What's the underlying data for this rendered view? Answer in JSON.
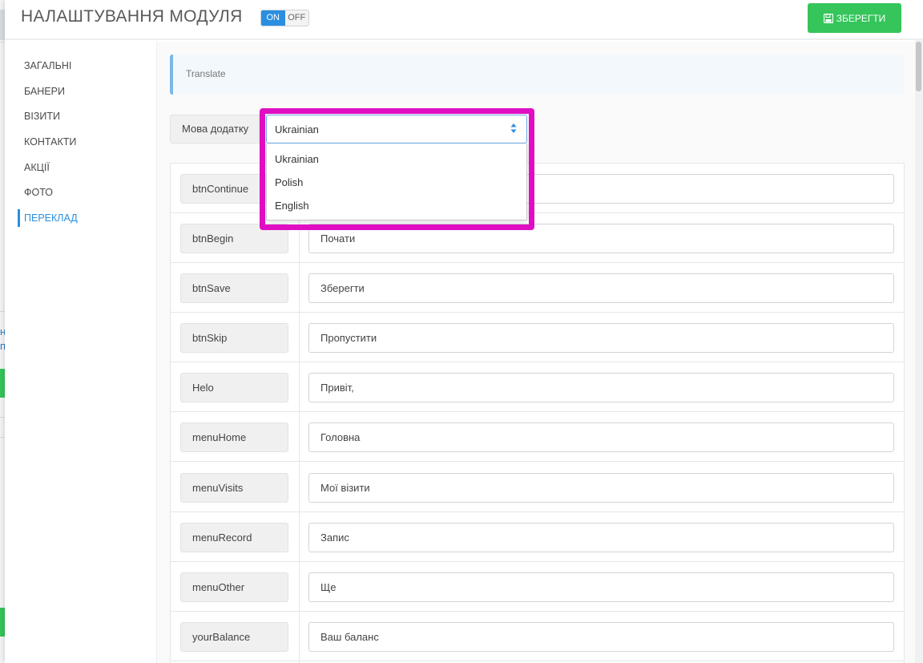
{
  "header": {
    "title": "НАЛАШТУВАННЯ МОДУЛЯ",
    "toggle": {
      "on_label": "ON",
      "off_label": "OFF"
    },
    "save_label": "ЗБЕРЕГТИ"
  },
  "sidebar": {
    "items": [
      {
        "label": "ЗАГАЛЬНІ"
      },
      {
        "label": "БАНЕРИ"
      },
      {
        "label": "ВІЗИТИ"
      },
      {
        "label": "КОНТАКТИ"
      },
      {
        "label": "АКЦІЇ"
      },
      {
        "label": "ФОТО"
      },
      {
        "label": "ПЕРЕКЛАД"
      }
    ],
    "active": "ПЕРЕКЛАД"
  },
  "main": {
    "banner": "Translate",
    "language": {
      "label": "Мова додатку",
      "selected": "Ukrainian",
      "options": [
        "Ukrainian",
        "Polish",
        "English"
      ]
    },
    "rows": [
      {
        "key": "btnContinue",
        "value": ""
      },
      {
        "key": "btnBegin",
        "value": "Почати"
      },
      {
        "key": "btnSave",
        "value": "Зберегти"
      },
      {
        "key": "btnSkip",
        "value": "Пропустити"
      },
      {
        "key": "Helo",
        "value": "Привіт,"
      },
      {
        "key": "menuHome",
        "value": "Головна"
      },
      {
        "key": "menuVisits",
        "value": "Мої візити"
      },
      {
        "key": "menuRecord",
        "value": "Запис"
      },
      {
        "key": "menuOther",
        "value": "Ще"
      },
      {
        "key": "yourBalance",
        "value": "Ваш баланс"
      }
    ]
  },
  "background": {
    "fragments": [
      "н",
      "п"
    ]
  },
  "colors": {
    "accent": "#2a8fe0",
    "save": "#35c55b",
    "highlight": "#e00ec2"
  }
}
